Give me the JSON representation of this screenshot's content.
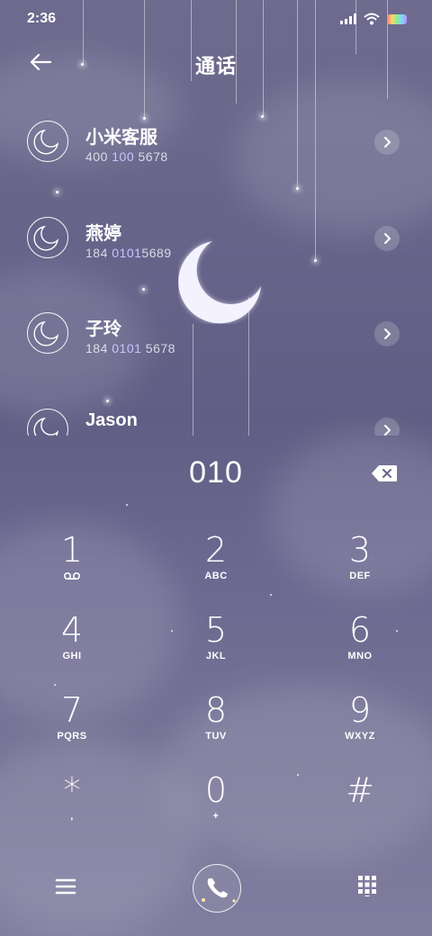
{
  "status_bar": {
    "time": "2:36"
  },
  "header": {
    "title": "通话"
  },
  "contacts": [
    {
      "name": "小米客服",
      "number_parts": [
        "400",
        " 100 ",
        "5678"
      ],
      "highlight": [
        false,
        true,
        false
      ]
    },
    {
      "name": "燕婷",
      "number_parts": [
        "184 ",
        "0101",
        "5689"
      ],
      "highlight": [
        false,
        true,
        false
      ]
    },
    {
      "name": "子玲",
      "number_parts": [
        "184 ",
        "0101",
        " 5678"
      ],
      "highlight": [
        false,
        true,
        false
      ]
    },
    {
      "name": "Jason",
      "number_parts": [
        "",
        "",
        ""
      ],
      "highlight": [
        false,
        false,
        false
      ]
    }
  ],
  "dialer": {
    "input": "010",
    "keys": [
      {
        "num": "1",
        "sub": ""
      },
      {
        "num": "2",
        "sub": "ABC"
      },
      {
        "num": "3",
        "sub": "DEF"
      },
      {
        "num": "4",
        "sub": "GHI"
      },
      {
        "num": "5",
        "sub": "JKL"
      },
      {
        "num": "6",
        "sub": "MNO"
      },
      {
        "num": "7",
        "sub": "PQRS"
      },
      {
        "num": "8",
        "sub": "TUV"
      },
      {
        "num": "9",
        "sub": "WXYZ"
      },
      {
        "num": "*",
        "sub": ","
      },
      {
        "num": "0",
        "sub": "+"
      },
      {
        "num": "#",
        "sub": ""
      }
    ]
  },
  "bottom_bar": {
    "menu_icon": "menu-icon",
    "call_icon": "phone-icon",
    "keypad_icon": "dialpad-icon"
  },
  "colors": {
    "highlight": "#c8c4ff",
    "background": "#67648a"
  }
}
